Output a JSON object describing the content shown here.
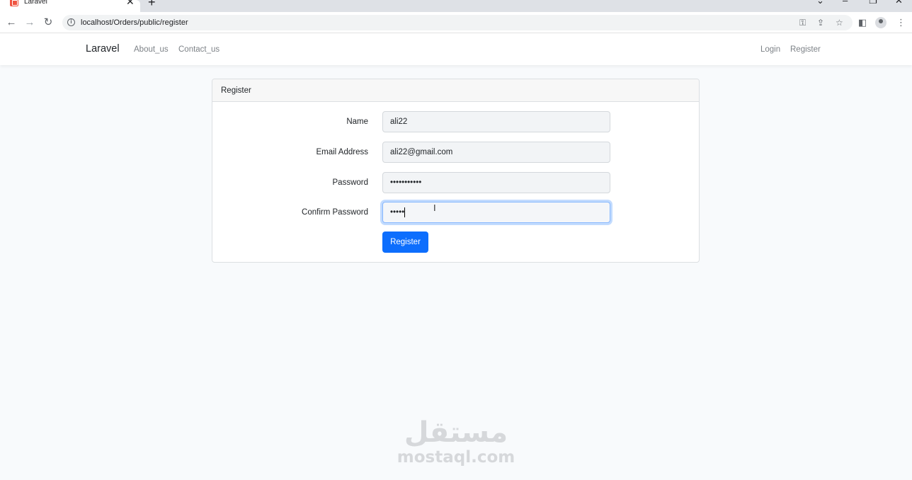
{
  "browser": {
    "tab_title": "Laravel",
    "url": "localhost/Orders/public/register"
  },
  "navbar": {
    "brand": "Laravel",
    "left_links": [
      "About_us",
      "Contact_us"
    ],
    "right_links": [
      "Login",
      "Register"
    ]
  },
  "card": {
    "header": "Register",
    "fields": [
      {
        "label": "Name",
        "value": "ali22"
      },
      {
        "label": "Email Address",
        "value": "ali22@gmail.com"
      },
      {
        "label": "Password",
        "value": "•••••••••••"
      },
      {
        "label": "Confirm Password",
        "value": "•••••"
      }
    ],
    "submit_label": "Register"
  },
  "watermark": {
    "arabic": "مستقل",
    "latin": "mostaql.com"
  },
  "colors": {
    "primary_button": "#0d6efd",
    "page_background": "#f8fafc"
  }
}
